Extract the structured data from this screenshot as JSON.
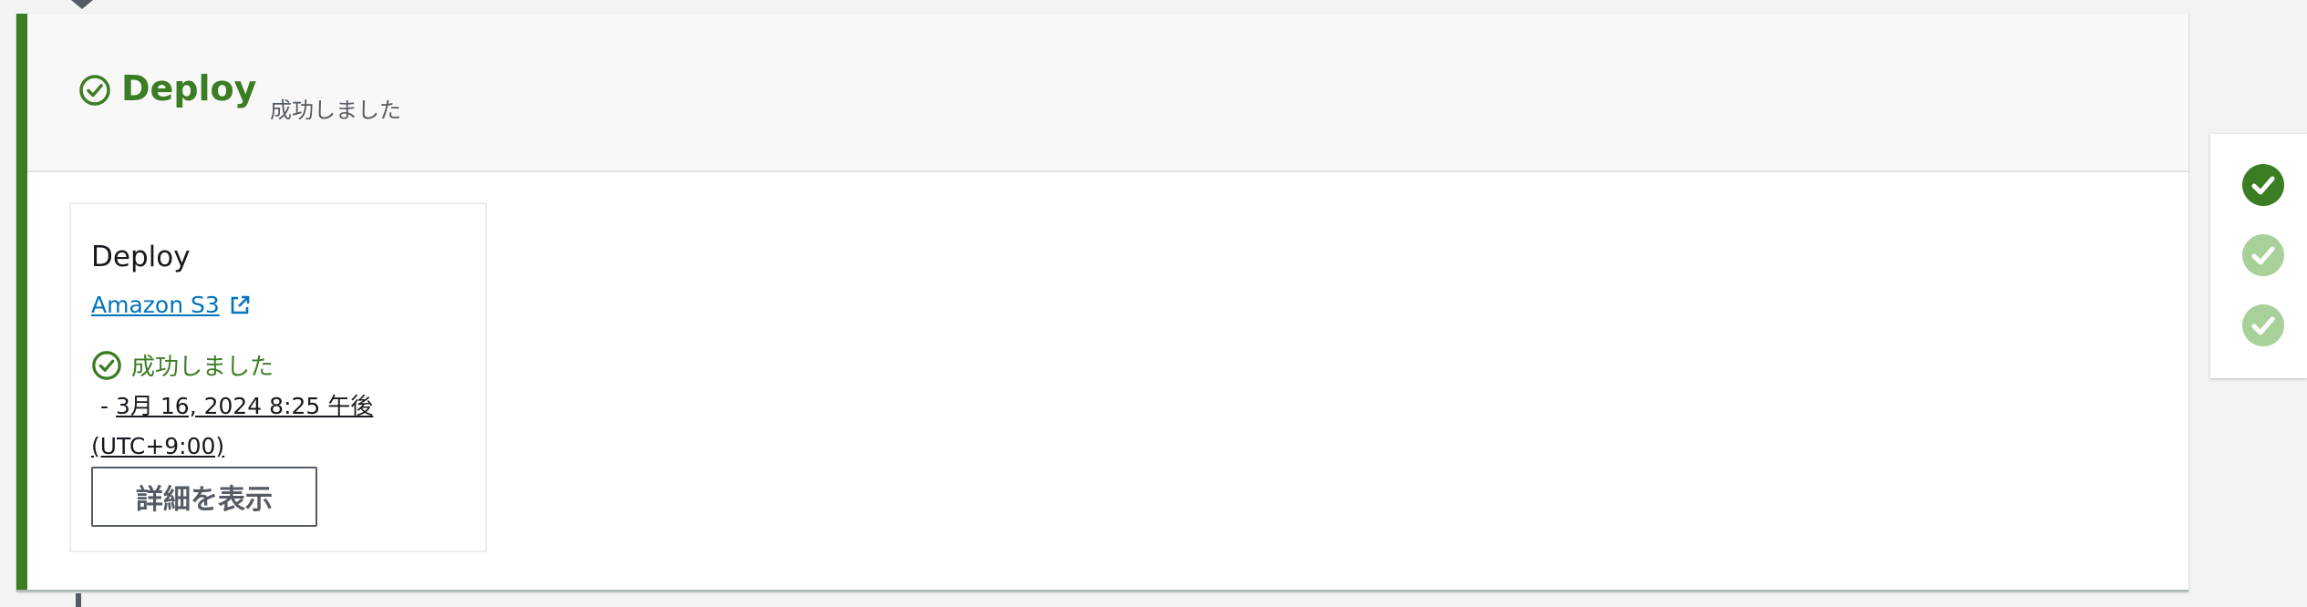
{
  "stage": {
    "title": "Deploy",
    "status_text": "成功しました",
    "status": "succeeded",
    "accent_color": "#3b7d23"
  },
  "action": {
    "title": "Deploy",
    "provider": "Amazon S3",
    "provider_icon": "external-link-icon",
    "status_text": "成功しました",
    "time_prefix": "-",
    "time_line1": "3月 16, 2024 8:25 午後",
    "time_line2": "(UTC+9:00)",
    "details_button": "詳細を表示"
  },
  "side_nav": {
    "items": [
      {
        "status": "succeeded",
        "active": true,
        "icon": "check-circle-icon"
      },
      {
        "status": "succeeded",
        "active": false,
        "icon": "check-circle-icon"
      },
      {
        "status": "succeeded",
        "active": false,
        "icon": "check-circle-icon"
      }
    ]
  },
  "colors": {
    "success": "#3b7d23",
    "success_faded": "#a8d19a",
    "link": "#0073bb",
    "text": "#16191f",
    "muted": "#545b64"
  }
}
